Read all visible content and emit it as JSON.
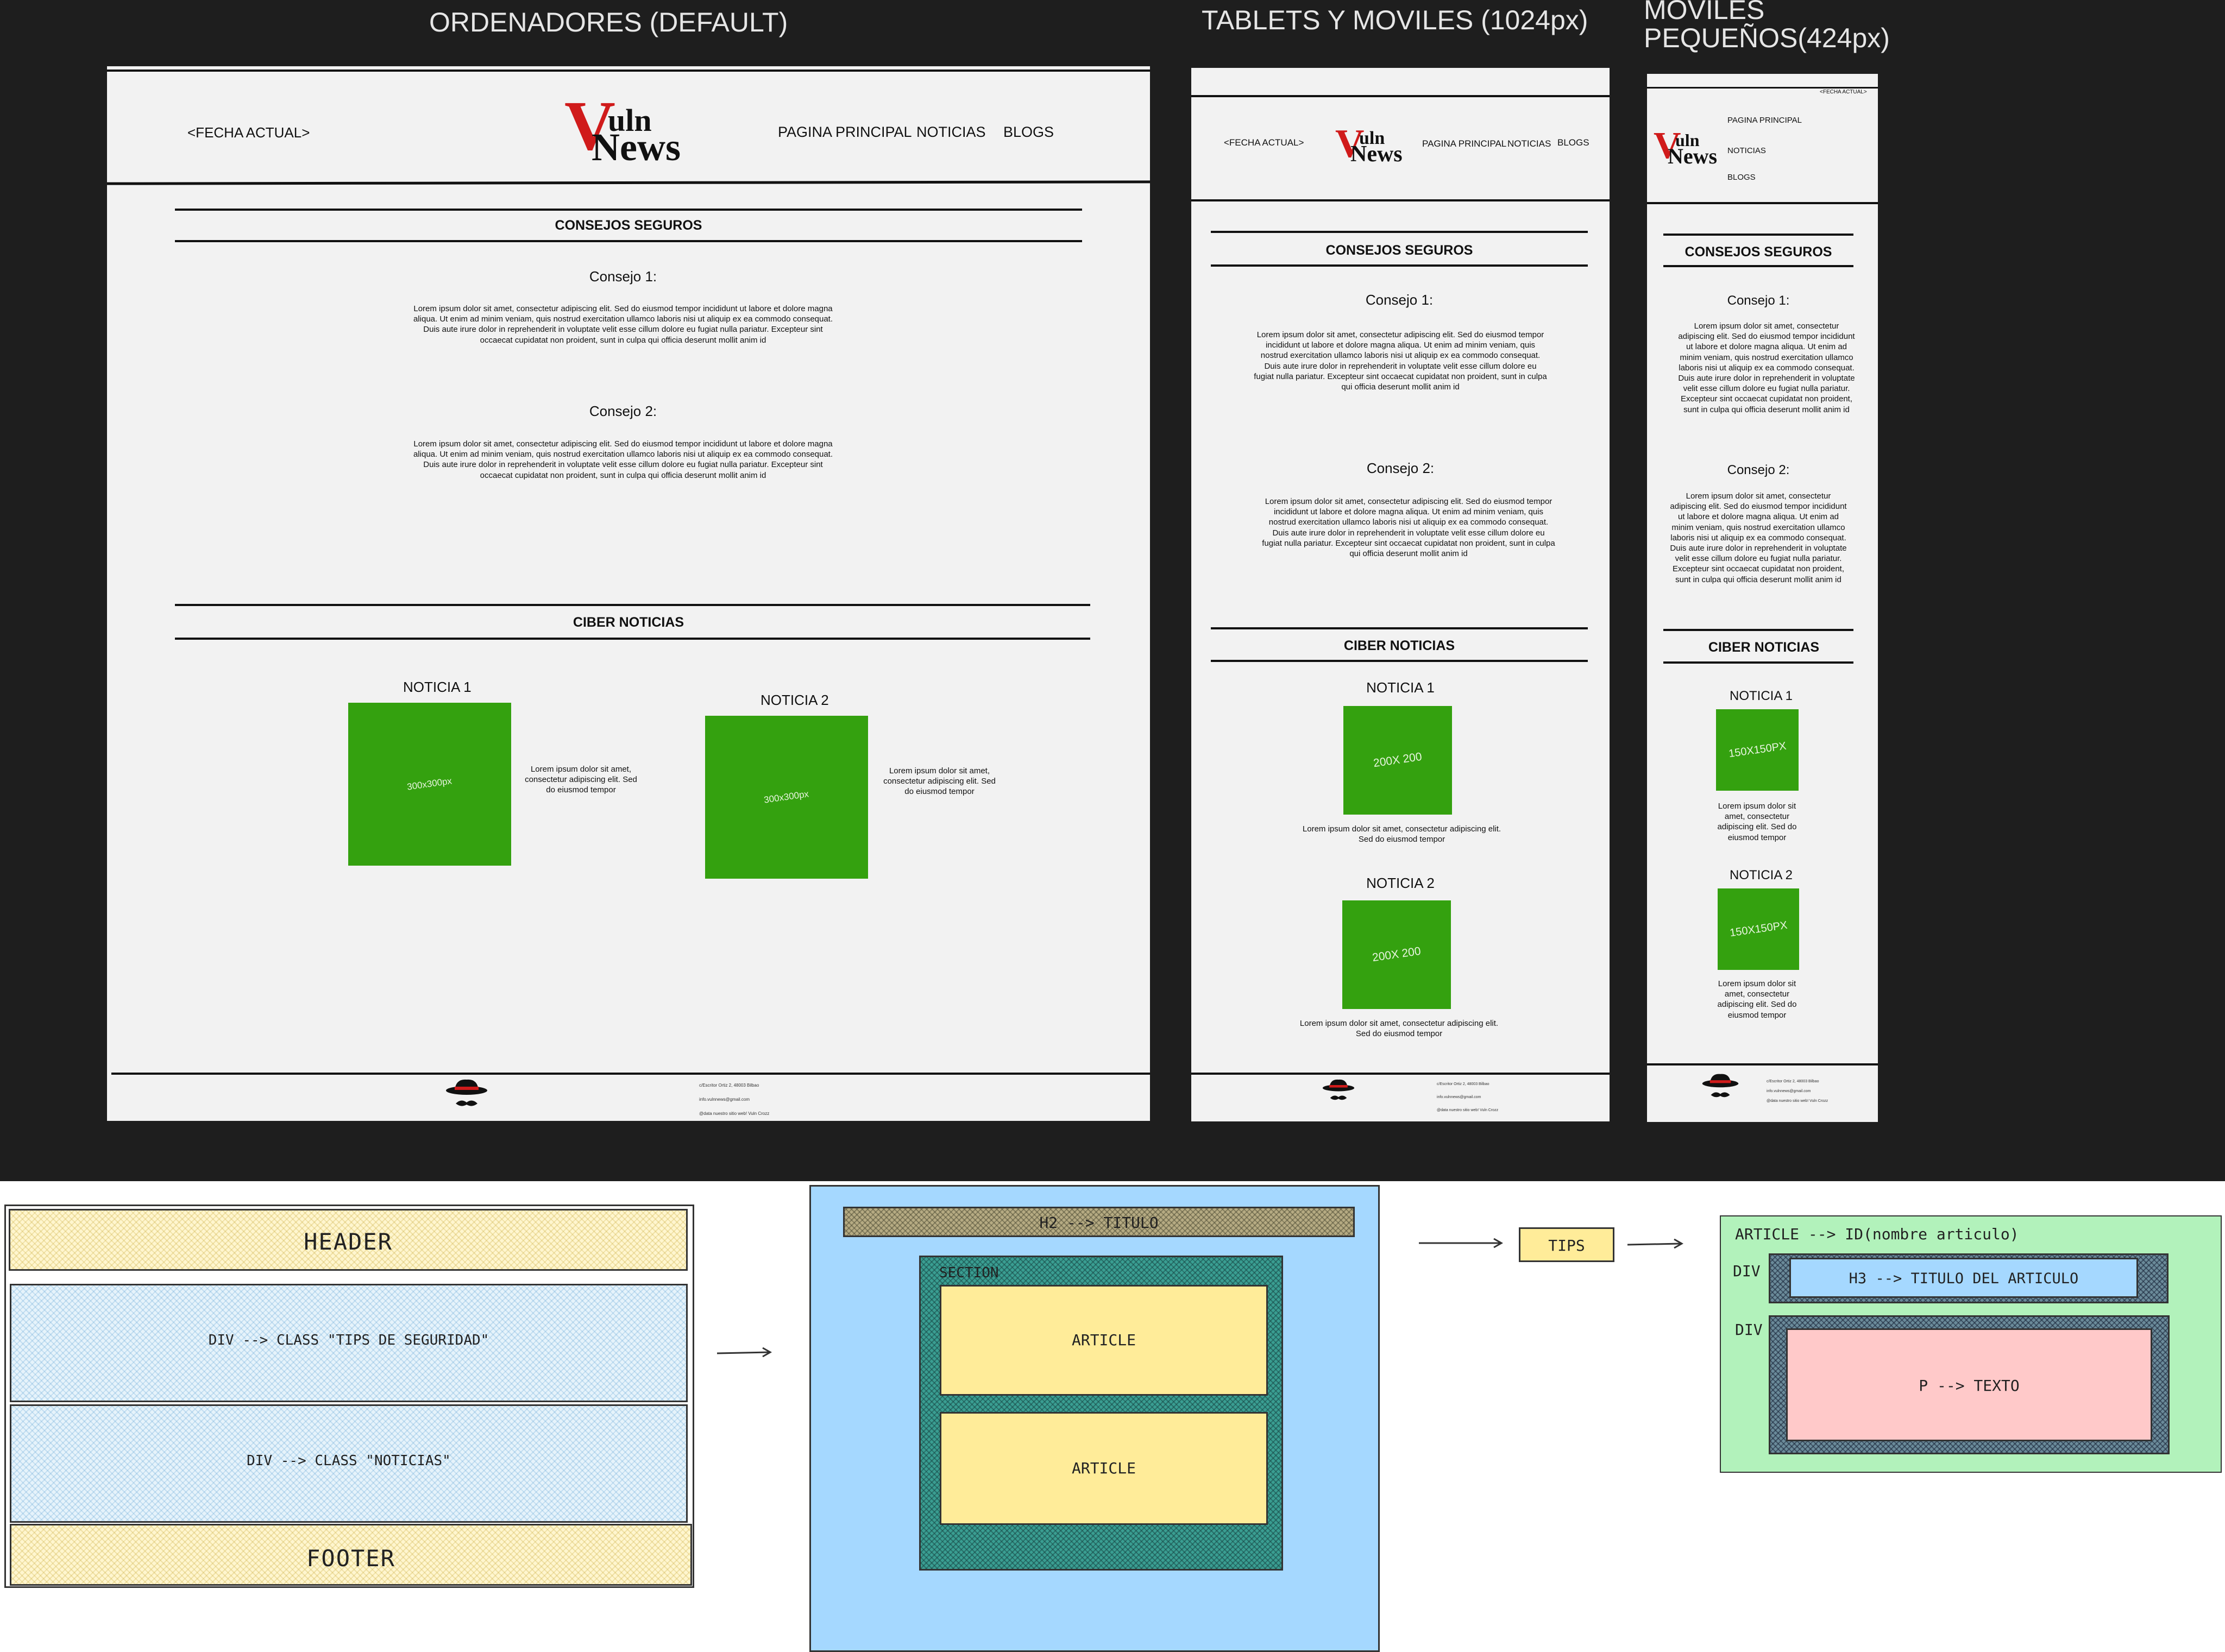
{
  "colors": {
    "canvas": "#1e1e1e",
    "frame": "#f2f2f2",
    "image_green": "#34a10f",
    "logo_red": "#d01b1b",
    "yellow_block": "#fff6cf",
    "blue_block": "#e6f3fb",
    "light_blue_panel": "#a8d6fb",
    "green_panel": "#b2f2bb",
    "pink_box": "#ffc9c9",
    "article_yellow": "#ffec99",
    "tips_yellow": "#ffec99"
  },
  "frame_titles": {
    "desktop": "ORDENADORES (DEFAULT)",
    "tablet": "TABLETS Y MOVILES (1024px)",
    "mobile_line1": "MOVILES",
    "mobile_line2": "PEQUEÑOS(424px)"
  },
  "logo": {
    "v": "V",
    "top": "uln",
    "bottom": "News"
  },
  "header": {
    "date": "<FECHA ACTUAL>",
    "nav": [
      "PAGINA PRINCIPAL",
      "NOTICIAS",
      "BLOGS"
    ]
  },
  "sections": {
    "tips_title": "CONSEJOS SEGUROS",
    "tip1": "Consejo 1:",
    "tip2": "Consejo 2:",
    "news_title": "CIBER NOTICIAS",
    "news1": "NOTICIA 1",
    "news2": "NOTICIA 2"
  },
  "lorem_long": "Lorem ipsum dolor sit amet, consectetur adipiscing elit. Sed do eiusmod tempor incididunt ut labore et dolore magna aliqua. Ut enim ad minim veniam, quis nostrud exercitation ullamco laboris nisi ut aliquip ex ea commodo consequat. Duis aute irure dolor in reprehenderit in voluptate velit esse cillum dolore eu fugiat nulla pariatur. Excepteur sint occaecat cupidatat non proident, sunt in culpa qui officia deserunt mollit anim id",
  "lorem_short": "Lorem ipsum dolor sit amet, consectetur adipiscing elit. Sed do eiusmod tempor",
  "images": {
    "desktop": "300x300px",
    "tablet": "200X 200",
    "mobile": "150X150PX"
  },
  "footer": {
    "address": "c/Escritor Ortiz 2, 48003 Bilbao",
    "email": "info.vulnnews@gmail.com",
    "copyright": "@data nuestro sitio web! Vuln Crozz"
  },
  "structure": {
    "header": "HEADER",
    "div_tips": "DIV --> CLASS \"TIPS DE SEGURIDAD\"",
    "div_news": "DIV --> CLASS \"NOTICIAS\"",
    "footer": "FOOTER",
    "h2": "H2 --> TITULO",
    "section": "SECTION",
    "article": "ARTICLE",
    "tips": "TIPS",
    "article_id": "ARTICLE --> ID(nombre articulo)",
    "div": "DIV",
    "h3": "H3 --> TITULO DEL ARTICULO",
    "p": "P --> TEXTO"
  }
}
